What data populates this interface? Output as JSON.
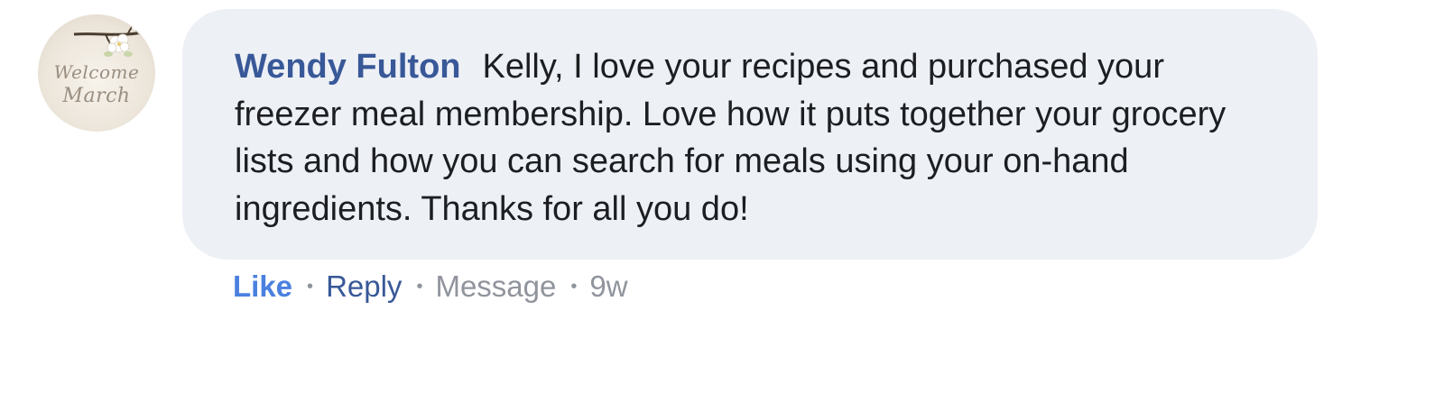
{
  "comment": {
    "author": "Wendy Fulton",
    "text": "Kelly, I love your recipes and purchased your freezer meal membership. Love how it puts together your grocery lists and how you can search for meals using your on-hand ingredients. Thanks for all you do!",
    "avatar": {
      "line1": "Welcome",
      "line2": "March"
    }
  },
  "actions": {
    "like": "Like",
    "reply": "Reply",
    "message": "Message",
    "timestamp": "9w",
    "separator": "•"
  },
  "colors": {
    "bubble_background": "#edf0f5",
    "author_name": "#385898",
    "like": "#4a80e0",
    "reply": "#385898",
    "meta": "#90949c",
    "text": "#1c1e21"
  }
}
